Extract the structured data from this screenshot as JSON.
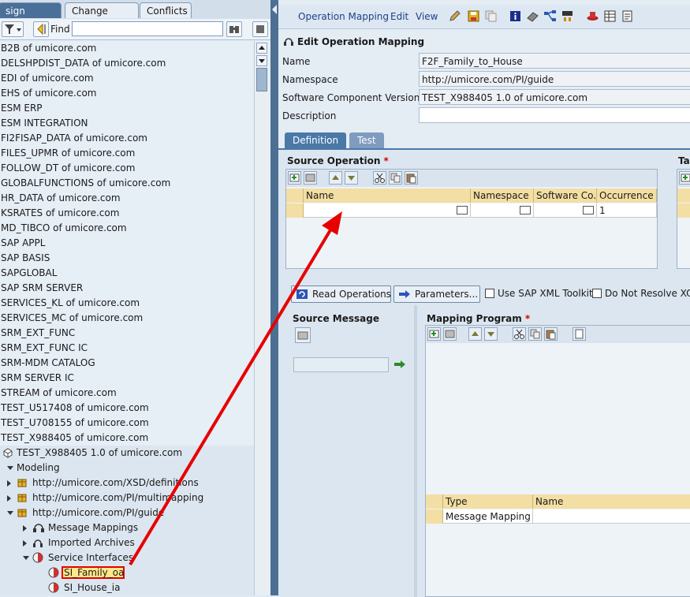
{
  "left_tabs": [
    "sign Objects",
    "Change Lists",
    "Conflicts"
  ],
  "find_label": "Find",
  "find_value": "",
  "tree": {
    "namespaces": [
      "B2B of umicore.com",
      "DELSHPDIST_DATA of umicore.com",
      "EDI of umicore.com",
      "EHS of umicore.com",
      "ESM ERP",
      "ESM INTEGRATION",
      "FI2FISAP_DATA of umicore.com",
      "FILES_UPMR of umicore.com",
      "FOLLOW_DT of umicore.com",
      "GLOBALFUNCTIONS of umicore.com",
      "HR_DATA of umicore.com",
      "KSRATES of umicore.com",
      "MD_TIBCO of umicore.com",
      "SAP APPL",
      "SAP BASIS",
      "SAPGLOBAL",
      "SAP SRM SERVER",
      "SERVICES_KL of umicore.com",
      "SERVICES_MC of umicore.com",
      "SRM_EXT_FUNC",
      "SRM_EXT_FUNC IC",
      "SRM-MDM CATALOG",
      "SRM SERVER IC",
      "STREAM of umicore.com",
      "TEST_U517408 of umicore.com",
      "TEST_U708155 of umicore.com",
      "TEST_X988405 of umicore.com"
    ],
    "swcv": "TEST_X988405 1.0 of umicore.com",
    "modeling": "Modeling",
    "ns_nodes": [
      "http://umicore.com/XSD/definitions",
      "http://umicore.com/PI/multimapping",
      "http://umicore.com/PI/guide"
    ],
    "sub_nodes": [
      "Message Mappings",
      "Imported Archives",
      "Service Interfaces"
    ],
    "leaves": [
      "SI_Family_oa",
      "SI_House_ia"
    ]
  },
  "menu": [
    "Operation Mapping",
    "Edit",
    "View"
  ],
  "editor": {
    "title": "Edit Operation Mapping",
    "fields": [
      {
        "label": "Name",
        "value": "F2F_Family_to_House"
      },
      {
        "label": "Namespace",
        "value": "http://umicore.com/PI/guide"
      },
      {
        "label": "Software Component Version",
        "value": "TEST_X988405 1.0 of umicore.com"
      },
      {
        "label": "Description",
        "value": ""
      }
    ],
    "tabs": [
      "Definition",
      "Test"
    ],
    "source_operation": {
      "title": "Source Operation",
      "required_mark": "*",
      "columns": [
        "Name",
        "Namespace",
        "Software Co...",
        "Occurrence"
      ],
      "row": {
        "name": "",
        "namespace": "",
        "swc": "",
        "occurrence": "1"
      }
    },
    "target_title_partial": "Ta",
    "read_operations": "Read Operations",
    "parameters": "Parameters...",
    "use_sap_xml": "Use SAP XML Toolkit",
    "do_not_resolve": "Do Not Resolve XOP",
    "source_message": "Source Message",
    "mapping_program": {
      "title": "Mapping Program",
      "required_mark": "*",
      "columns": [
        "Type",
        "Name"
      ],
      "row": {
        "type": "Message Mapping",
        "name": ""
      }
    }
  },
  "colors": {
    "splitter": "#4d6f93",
    "active_tab": "#4a6f98",
    "table_header": "#f3dfa4",
    "highlight": "#ffe98a",
    "annotation_arrow": "#e60000",
    "link": "#1f3f88"
  }
}
